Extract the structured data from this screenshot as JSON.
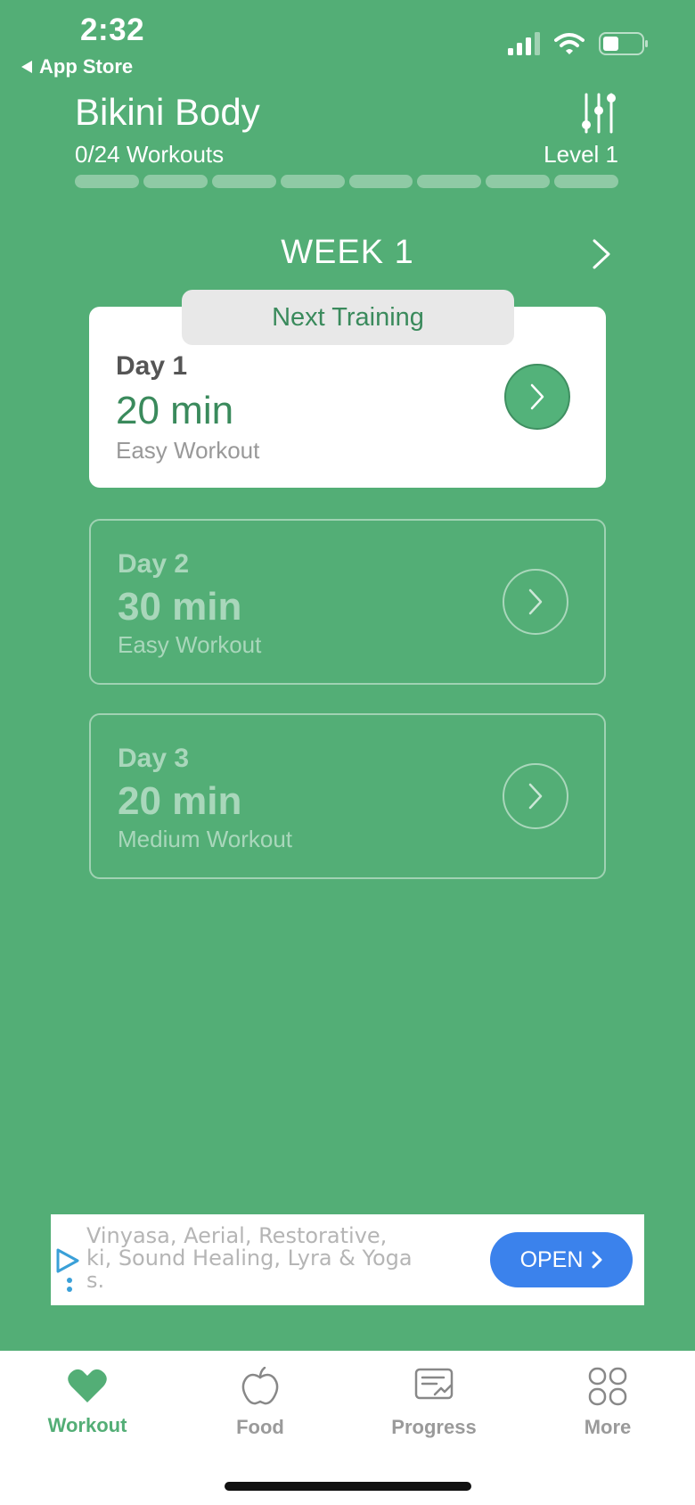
{
  "status_bar": {
    "time": "2:32",
    "back_app": "App Store"
  },
  "header": {
    "title": "Bikini Body",
    "progress_text": "0/24 Workouts",
    "level": "Level 1",
    "progress_segments": 8,
    "completed_segments": 0
  },
  "week": {
    "label": "WEEK 1"
  },
  "next_training_label": "Next Training",
  "days": [
    {
      "day": "Day 1",
      "duration": "20 min",
      "type": "Easy Workout"
    },
    {
      "day": "Day 2",
      "duration": "30 min",
      "type": "Easy Workout"
    },
    {
      "day": "Day 3",
      "duration": "20 min",
      "type": "Medium Workout"
    }
  ],
  "ad": {
    "text": "Vinyasa, Aerial, Restorative,\nki, Sound Healing, Lyra & Yoga\ns.",
    "button": "OPEN"
  },
  "tabs": [
    {
      "label": "Workout",
      "icon": "heart-icon",
      "active": true
    },
    {
      "label": "Food",
      "icon": "apple-icon"
    },
    {
      "label": "Progress",
      "icon": "progress-chart-icon"
    },
    {
      "label": "More",
      "icon": "grid-icon"
    }
  ],
  "colors": {
    "background": "#53ae76",
    "accent_dark": "#3a8a5c",
    "ad_button": "#3b82ec"
  }
}
